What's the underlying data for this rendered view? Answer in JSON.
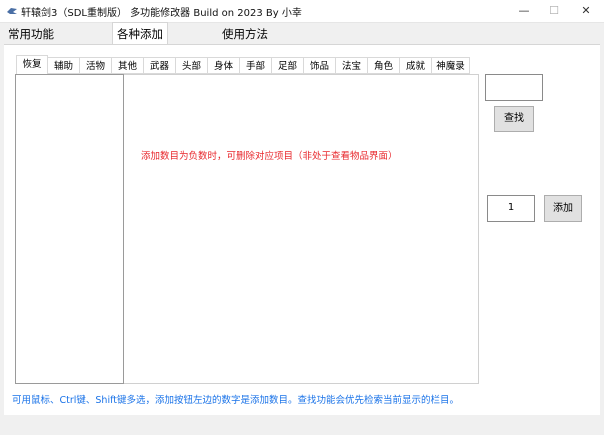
{
  "window": {
    "title": "轩辕剑3（SDL重制版）  多功能修改器  Build on 2023 By 小幸",
    "minimize_glyph": "—",
    "maximize_glyph": "☐",
    "close_glyph": "✕"
  },
  "main_tabs": [
    {
      "label": "常用功能"
    },
    {
      "label": "各种添加"
    },
    {
      "label": "使用方法"
    }
  ],
  "sub_tabs": [
    {
      "label": "恢复"
    },
    {
      "label": "辅助"
    },
    {
      "label": "活物"
    },
    {
      "label": "其他"
    },
    {
      "label": "武器"
    },
    {
      "label": "头部"
    },
    {
      "label": "身体"
    },
    {
      "label": "手部"
    },
    {
      "label": "足部"
    },
    {
      "label": "饰品"
    },
    {
      "label": "法宝"
    },
    {
      "label": "角色"
    },
    {
      "label": "成就"
    },
    {
      "label": "神魔录"
    }
  ],
  "active_sub_tab": "恢复",
  "hint_red": "添加数目为负数时，可删除对应项目（非处于查看物品界面）",
  "search": {
    "value": "",
    "button_label": "查找"
  },
  "add": {
    "quantity": "1",
    "button_label": "添加"
  },
  "footer_hint": "可用鼠标、Ctrl键、Shift键多选，添加按钮左边的数字是添加数目。查找功能会优先检索当前显示的栏目。",
  "colors": {
    "hint_red": "#e8282d",
    "footer_blue": "#1a73e8"
  }
}
